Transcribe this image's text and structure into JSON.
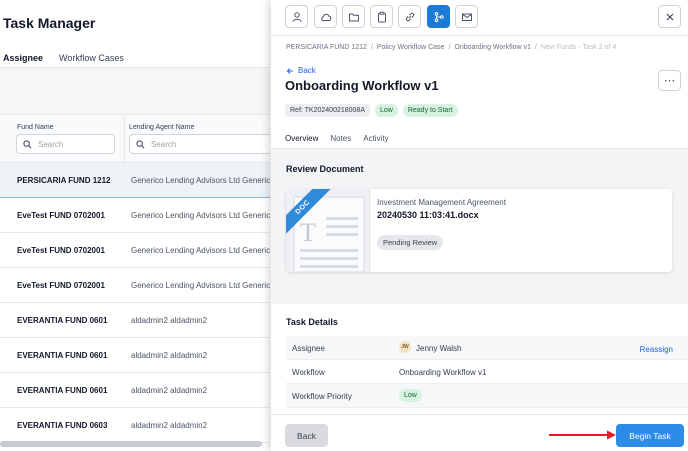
{
  "app": {
    "title": "Task Manager",
    "tabs": [
      "Assignee",
      "Workflow Cases"
    ]
  },
  "grid": {
    "columns": [
      "Fund Name",
      "Lending Agent Name"
    ],
    "search_placeholder": "Search",
    "rows": [
      {
        "fund": "PERSICARIA FUND 1212",
        "agent": "Generico Lending Advisors Ltd Generic"
      },
      {
        "fund": "EveTest FUND 0702001",
        "agent": "Generico Lending Advisors Ltd Generic"
      },
      {
        "fund": "EveTest FUND 0702001",
        "agent": "Generico Lending Advisors Ltd Generic"
      },
      {
        "fund": "EveTest FUND 0702001",
        "agent": "Generico Lending Advisors Ltd Generic"
      },
      {
        "fund": "EVERANTIA FUND 0601",
        "agent": "aldadmin2 aldadmin2"
      },
      {
        "fund": "EVERANTIA FUND 0601",
        "agent": "aldadmin2 aldadmin2"
      },
      {
        "fund": "EVERANTIA FUND 0601",
        "agent": "aldadmin2 aldadmin2"
      },
      {
        "fund": "EVERANTIA FUND 0603",
        "agent": "aldadmin2 aldadmin2"
      }
    ]
  },
  "panel": {
    "toolbar_icons": [
      "user-icon",
      "cloud-icon",
      "folder-icon",
      "clipboard-icon",
      "link-icon",
      "workflow-icon",
      "mail-icon"
    ],
    "breadcrumb": [
      "PERSICARIA FUND 1212",
      "Policy Workflow Case",
      "Onboarding Workflow v1",
      "New Funds - Task 2 of 4"
    ],
    "back_label": "Back",
    "title": "Onboarding Workflow v1",
    "ref": "Ref: TK202400218008A",
    "priority_chip": "Low",
    "status_chip": "Ready to Start",
    "tabs": [
      "Overview",
      "Notes",
      "Activity"
    ],
    "review_title": "Review Document",
    "doc": {
      "ribbon": "DOC",
      "label": "Investment Management Agreement",
      "name": "20240530 11:03:41.docx",
      "status": "Pending Review"
    },
    "details_title": "Task Details",
    "details": {
      "assignee_key": "Assignee",
      "assignee_initials": "JW",
      "assignee_val": "Jenny Walsh",
      "reassign": "Reassign",
      "workflow_key": "Workflow",
      "workflow_val": "Onboarding Workflow v1",
      "priority_key": "Workflow Priority",
      "priority_val": "Low"
    },
    "back_button": "Back",
    "begin_button": "Begin Task"
  },
  "colors": {
    "accent": "#2d8ce8",
    "arrow": "#e11d2a",
    "chip_green": "#d7f2e0"
  }
}
